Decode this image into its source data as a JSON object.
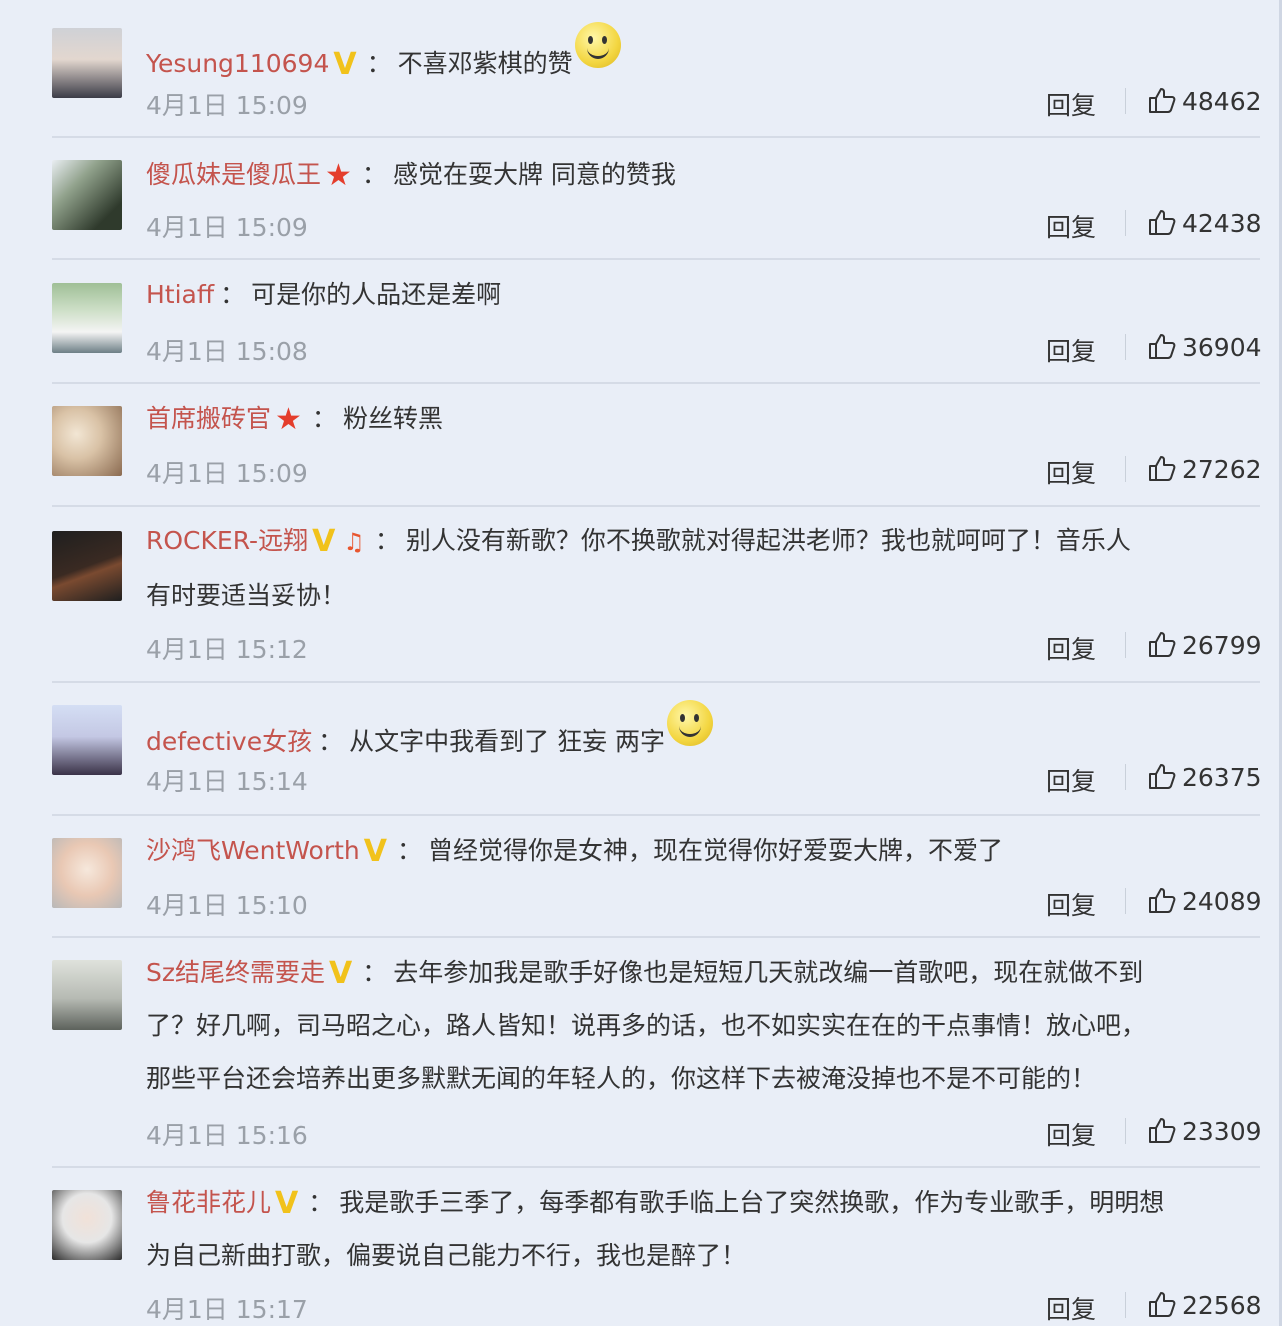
{
  "reply_label": "回复",
  "comments": [
    {
      "user": "Yesung110694",
      "badge": "v",
      "text": "不喜邓紫棋的赞",
      "emoji": "smile",
      "time": "4月1日 15:09",
      "likes": "48462",
      "avatar_colors": [
        "#d9d3cf",
        "#3a3a45"
      ]
    },
    {
      "user": "傻瓜妹是傻瓜王",
      "badge": "star",
      "text": "感觉在耍大牌 同意的赞我",
      "emoji": null,
      "time": "4月1日 15:09",
      "likes": "42438",
      "avatar_colors": [
        "#7a8c6f",
        "#2f3a2c"
      ]
    },
    {
      "user": "Htiaff",
      "badge": null,
      "text": "可是你的人品还是差啊",
      "emoji": null,
      "time": "4月1日 15:08",
      "likes": "36904",
      "avatar_colors": [
        "#a9c7a0",
        "#f2f2f2"
      ]
    },
    {
      "user": "首席搬砖官",
      "badge": "star",
      "text": "粉丝转黑",
      "emoji": null,
      "time": "4月1日 15:09",
      "likes": "27262",
      "avatar_colors": [
        "#e9dcc8",
        "#8a6a50"
      ]
    },
    {
      "user": "ROCKER-远翔",
      "badge": "v",
      "text_lines": [
        "别人没有新歌？你不换歌就对得起洪老师？我也就呵呵了！音乐人",
        "有时要适当妥协！"
      ],
      "emoji": null,
      "time": "4月1日 15:12",
      "likes": "26799",
      "avatar_colors": [
        "#2a2a2a",
        "#5a3a2a"
      ]
    },
    {
      "user": "defective女孩",
      "badge": null,
      "text": "从文字中我看到了 狂妄 两字",
      "emoji": "smirk",
      "time": "4月1日 15:14",
      "likes": "26375",
      "avatar_colors": [
        "#c8d4ef",
        "#3a3248"
      ]
    },
    {
      "user": "沙鸿飞WentWorth",
      "badge": "v",
      "text": "曾经觉得你是女神，现在觉得你好爱耍大牌，不爱了",
      "emoji": null,
      "time": "4月1日 15:10",
      "likes": "24089",
      "avatar_colors": [
        "#f0e2d6",
        "#c98f74"
      ]
    },
    {
      "user": "Sz结尾终需要走",
      "badge": "v",
      "text_lines": [
        "去年参加我是歌手好像也是短短几天就改编一首歌吧，现在就做不到",
        "了？好几啊，司马昭之心，路人皆知！说再多的话，也不如实实在在的干点事情！放心吧，",
        "那些平台还会培养出更多默默无闻的年轻人的，你这样下去被淹没掉也不是不可能的！"
      ],
      "emoji": null,
      "time": "4月1日 15:16",
      "likes": "23309",
      "avatar_colors": [
        "#c2c6c0",
        "#5d625c"
      ]
    },
    {
      "user": "鲁花非花儿",
      "badge": "v",
      "text_lines": [
        "我是歌手三季了，每季都有歌手临上台了突然换歌，作为专业歌手，明明想",
        "为自己新曲打歌，偏要说自己能力不行，我也是醉了！"
      ],
      "emoji": null,
      "time": "4月1日 15:17",
      "likes": "22568",
      "avatar_colors": [
        "#e6e6e6",
        "#2b2b2b"
      ]
    }
  ]
}
